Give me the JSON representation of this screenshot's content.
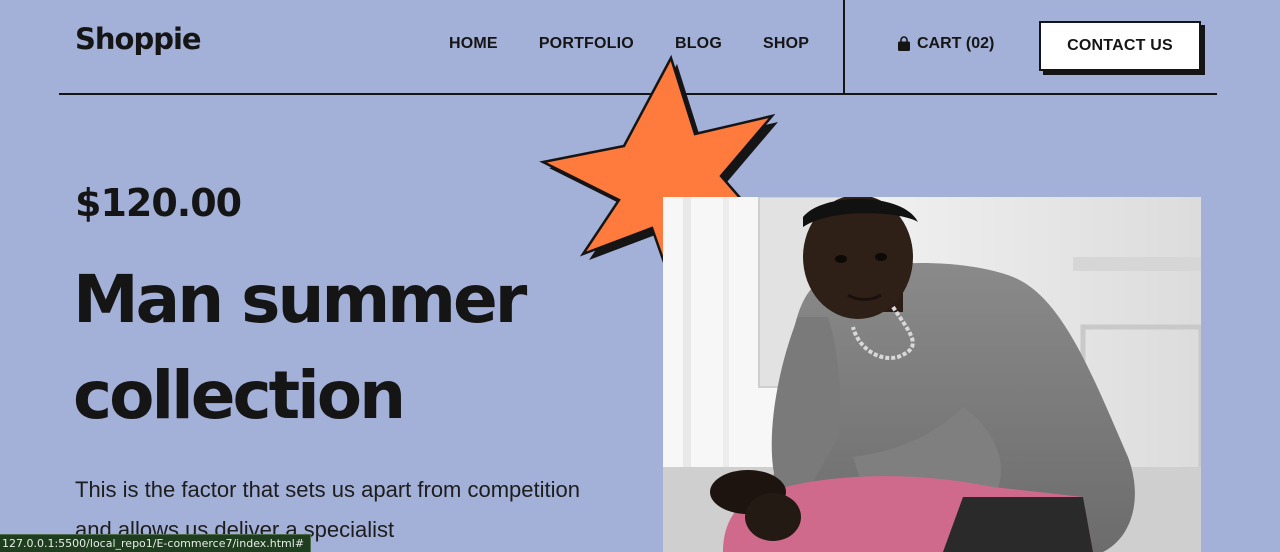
{
  "header": {
    "logo": "Shoppie",
    "nav": [
      "HOME",
      "PORTFOLIO",
      "BLOG",
      "SHOP"
    ],
    "cart_label": "CART (02)",
    "contact_label": "CONTACT US"
  },
  "hero": {
    "price": "$120.00",
    "title_line1": "Man summer",
    "title_line2": "collection",
    "description": "This is the factor that sets us apart from competition and allows us deliver a specialist",
    "star_color": "#ff7a3d",
    "background_color": "#a3b0d7"
  },
  "status_bar": {
    "url": "127.0.0.1:5500/local_repo1/E-commerce7/index.html#"
  },
  "icons": {
    "cart": "shopping-bag-icon",
    "decor": "star-burst-icon"
  }
}
